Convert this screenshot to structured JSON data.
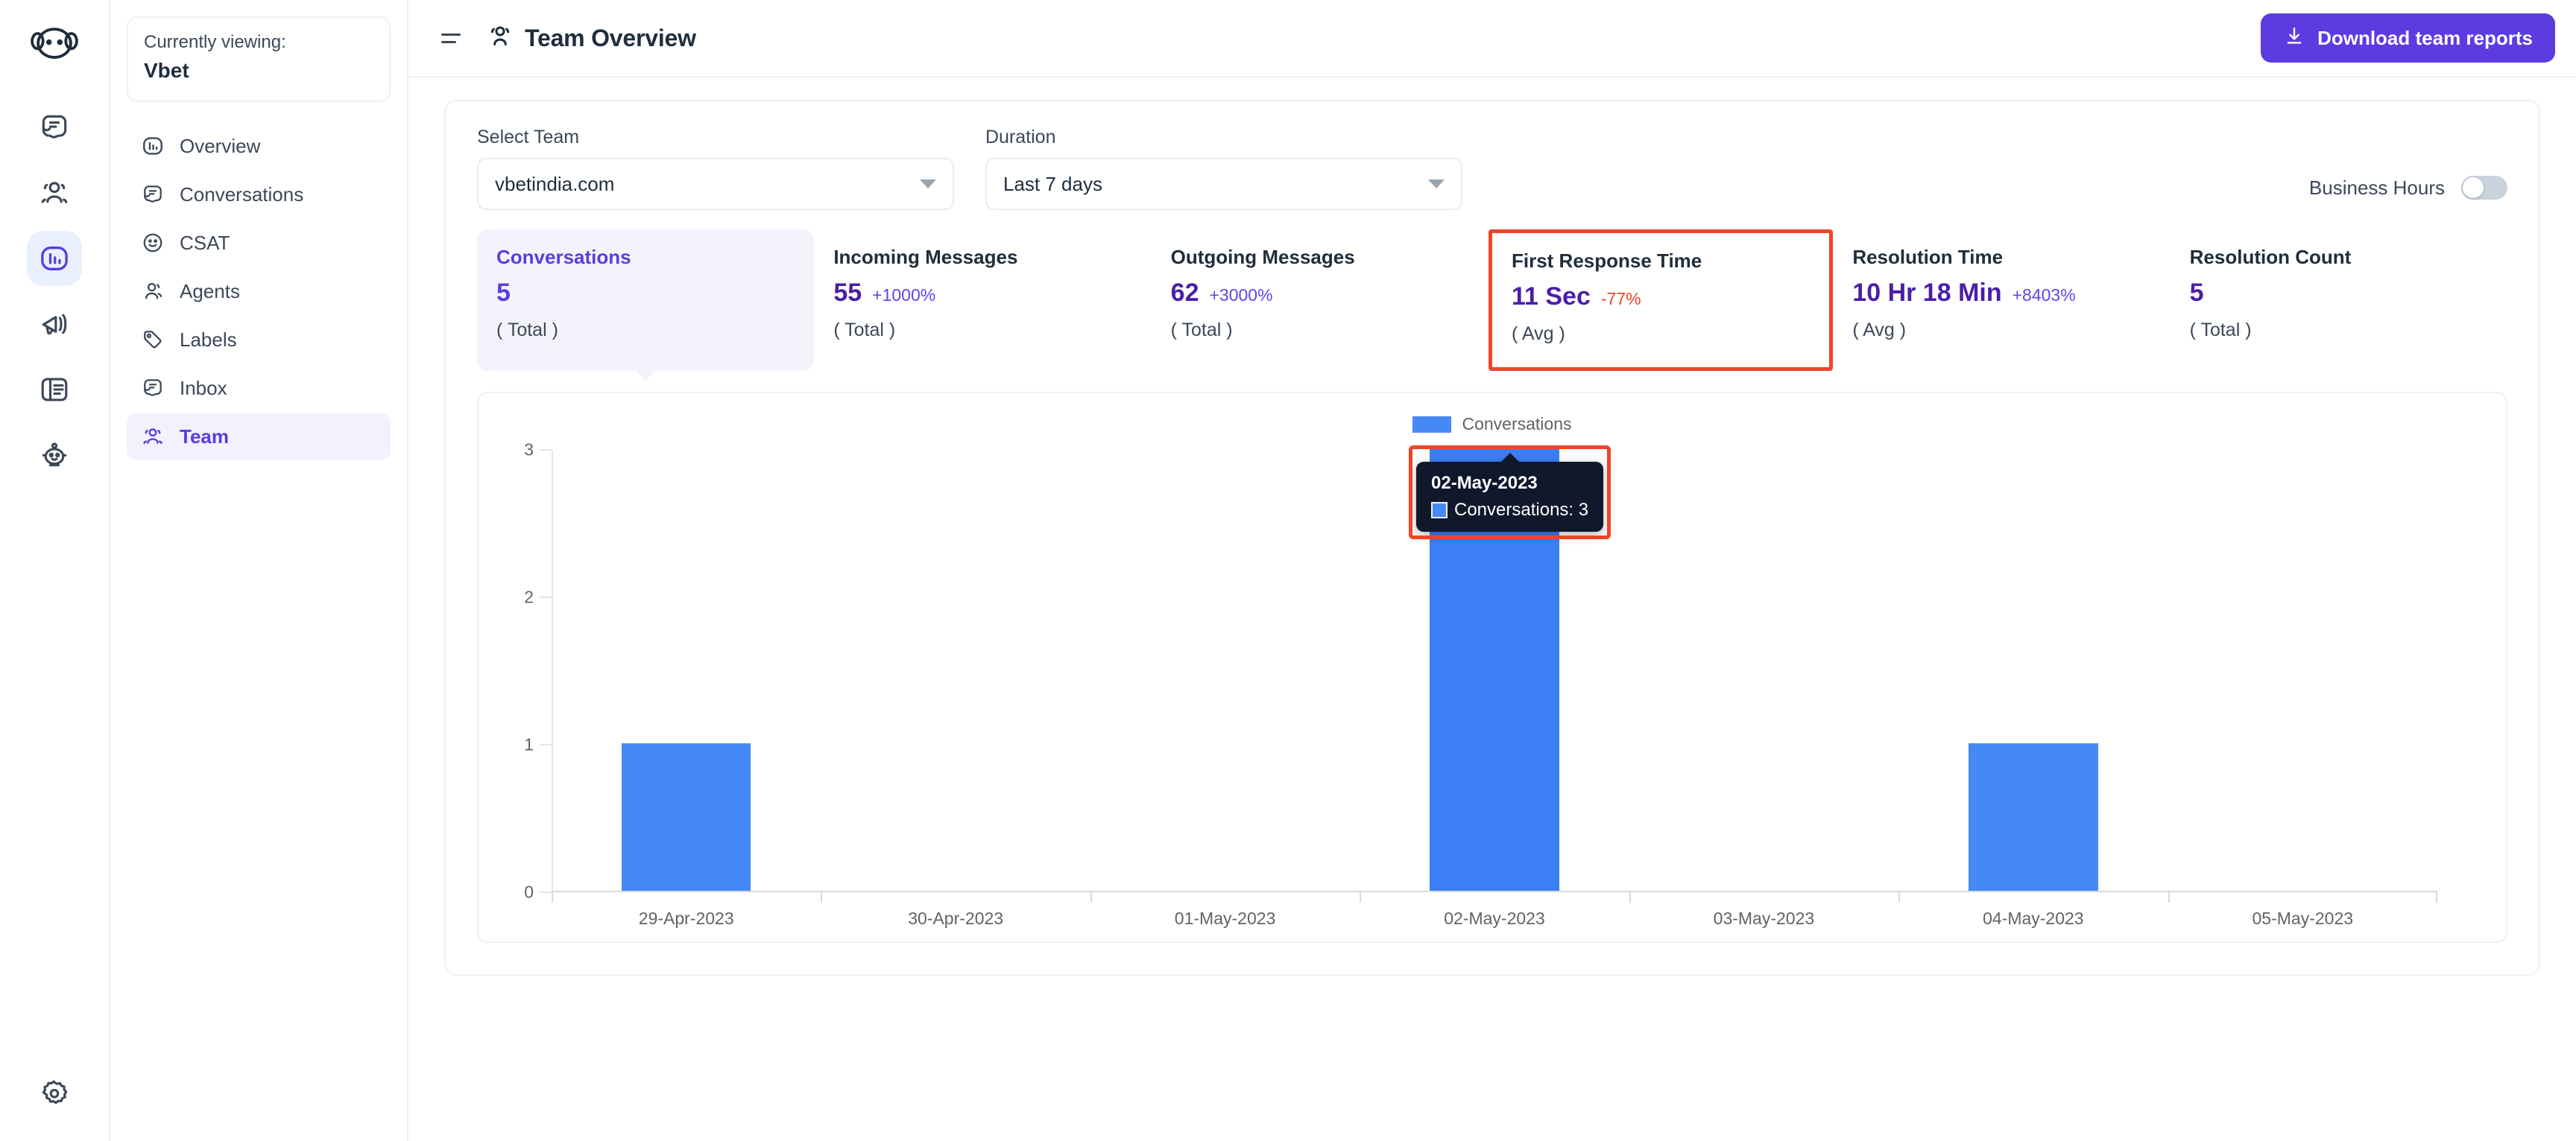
{
  "brand": {
    "accent": "#5b3ce0",
    "annotation": "#f1442a",
    "bar": "#4589f5",
    "bar_hover": "#3b7ef5"
  },
  "rail": {
    "logo_name": "chatwoot-logo",
    "items": [
      {
        "icon": "conversations-icon",
        "name": "rail-item-conversations",
        "active": false
      },
      {
        "icon": "contacts-icon",
        "name": "rail-item-contacts",
        "active": false
      },
      {
        "icon": "reports-icon",
        "name": "rail-item-reports",
        "active": true
      },
      {
        "icon": "campaigns-megaphone-icon",
        "name": "rail-item-campaigns",
        "active": false
      },
      {
        "icon": "portal-book-icon",
        "name": "rail-item-help-center",
        "active": false
      },
      {
        "icon": "bot-icon",
        "name": "rail-item-bots",
        "active": false
      },
      {
        "icon": "gear-icon",
        "name": "rail-item-settings",
        "active": false
      }
    ]
  },
  "sidebar": {
    "viewing_label": "Currently viewing:",
    "viewing_name": "Vbet",
    "items": [
      {
        "label": "Overview",
        "icon": "bar-chart-icon",
        "active": false
      },
      {
        "label": "Conversations",
        "icon": "conversations-icon",
        "active": false
      },
      {
        "label": "CSAT",
        "icon": "smiley-icon",
        "active": false
      },
      {
        "label": "Agents",
        "icon": "agent-person-icon",
        "active": false
      },
      {
        "label": "Labels",
        "icon": "tag-icon",
        "active": false
      },
      {
        "label": "Inbox",
        "icon": "inbox-icon",
        "active": false
      },
      {
        "label": "Team",
        "icon": "team-people-icon",
        "active": true
      }
    ]
  },
  "topbar": {
    "menu_icon": "hamburger-icon",
    "title_icon": "team-people-icon",
    "title": "Team Overview",
    "download_icon": "download-icon",
    "download_label": "Download team reports"
  },
  "filters": {
    "team": {
      "label": "Select Team",
      "value": "vbetindia.com"
    },
    "duration": {
      "label": "Duration",
      "value": "Last 7 days"
    },
    "business_hours": {
      "label": "Business Hours",
      "enabled": false
    }
  },
  "metrics": [
    {
      "title": "Conversations",
      "value": "5",
      "delta": "",
      "delta_sign": "",
      "sub": "( Total )",
      "selected": true,
      "annotated": false
    },
    {
      "title": "Incoming Messages",
      "value": "55",
      "delta": "+1000%",
      "delta_sign": "pos",
      "sub": "( Total )",
      "selected": false,
      "annotated": false
    },
    {
      "title": "Outgoing Messages",
      "value": "62",
      "delta": "+3000%",
      "delta_sign": "pos",
      "sub": "( Total )",
      "selected": false,
      "annotated": false
    },
    {
      "title": "First Response Time",
      "value": "11 Sec",
      "delta": "-77%",
      "delta_sign": "neg",
      "sub": "( Avg )",
      "selected": false,
      "annotated": true
    },
    {
      "title": "Resolution Time",
      "value": "10 Hr 18 Min",
      "delta": "+8403%",
      "delta_sign": "pos",
      "sub": "( Avg )",
      "selected": false,
      "annotated": false
    },
    {
      "title": "Resolution Count",
      "value": "5",
      "delta": "",
      "delta_sign": "",
      "sub": "( Total )",
      "selected": false,
      "annotated": false
    }
  ],
  "chart_data": {
    "type": "bar",
    "title": "",
    "xlabel": "",
    "ylabel": "",
    "legend": [
      {
        "name": "Conversations",
        "color": "#4589f5"
      }
    ],
    "legend_position": "top-center",
    "grid": false,
    "categories": [
      "29-Apr-2023",
      "30-Apr-2023",
      "01-May-2023",
      "02-May-2023",
      "03-May-2023",
      "04-May-2023",
      "05-May-2023"
    ],
    "series": [
      {
        "name": "Conversations",
        "values": [
          1,
          0,
          0,
          3,
          0,
          1,
          0
        ]
      }
    ],
    "yticks": [
      0,
      1,
      2,
      3
    ],
    "ylim": [
      0,
      3
    ],
    "hovered_index": 3,
    "tooltip": {
      "title": "02-May-2023",
      "series_label": "Conversations: 3",
      "swatch_color": "#4589f5",
      "annotated": true
    }
  }
}
